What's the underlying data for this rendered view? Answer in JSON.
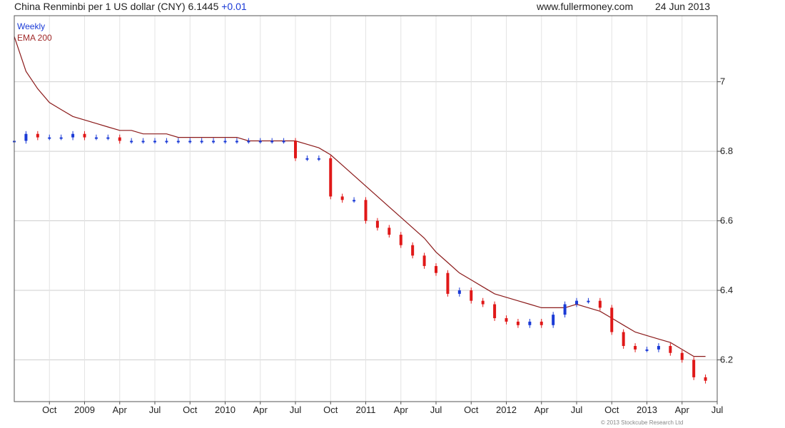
{
  "header": {
    "title": "China Renminbi per 1 US dollar (CNY) 6.1445",
    "change": "+0.01",
    "site": "www.fullermoney.com",
    "date": "24 Jun 2013"
  },
  "legend": {
    "line1": "Weekly",
    "line2": "EMA 200"
  },
  "copyright": "© 2013 Stockcube Research Ltd",
  "colors": {
    "up": "#1a3ad6",
    "down": "#e01818",
    "ema": "#8b1a1a",
    "grid": "#cfcfcf",
    "frame": "#555555"
  },
  "chart_data": {
    "type": "line",
    "title": "China Renminbi per 1 US dollar (CNY) 6.1445",
    "x_ticks": [
      "Oct",
      "2009",
      "Apr",
      "Jul",
      "Oct",
      "2010",
      "Apr",
      "Jul",
      "Oct",
      "2011",
      "Apr",
      "Jul",
      "Oct",
      "2012",
      "Apr",
      "Jul",
      "Oct",
      "2013",
      "Apr",
      "Jul"
    ],
    "y_ticks": [
      "6.2",
      "6.4",
      "6.6",
      "6.8",
      "7"
    ],
    "ylim": [
      6.08,
      7.19
    ],
    "xlim": [
      "2008-07",
      "2013-07"
    ],
    "grid": true,
    "legend_position": "top-left",
    "series": [
      {
        "name": "Weekly",
        "style": "candlestick",
        "x": [
          "2008-07",
          "2008-08",
          "2008-09",
          "2008-10",
          "2008-11",
          "2008-12",
          "2009-01",
          "2009-02",
          "2009-03",
          "2009-04",
          "2009-05",
          "2009-06",
          "2009-07",
          "2009-08",
          "2009-09",
          "2009-10",
          "2009-11",
          "2009-12",
          "2010-01",
          "2010-02",
          "2010-03",
          "2010-04",
          "2010-05",
          "2010-06",
          "2010-07",
          "2010-08",
          "2010-09",
          "2010-10",
          "2010-11",
          "2010-12",
          "2011-01",
          "2011-02",
          "2011-03",
          "2011-04",
          "2011-05",
          "2011-06",
          "2011-07",
          "2011-08",
          "2011-09",
          "2011-10",
          "2011-11",
          "2011-12",
          "2012-01",
          "2012-02",
          "2012-03",
          "2012-04",
          "2012-05",
          "2012-06",
          "2012-07",
          "2012-08",
          "2012-09",
          "2012-10",
          "2012-11",
          "2012-12",
          "2013-01",
          "2013-02",
          "2013-03",
          "2013-04",
          "2013-05",
          "2013-06"
        ],
        "values": [
          6.83,
          6.85,
          6.84,
          6.84,
          6.84,
          6.85,
          6.84,
          6.84,
          6.84,
          6.83,
          6.83,
          6.83,
          6.83,
          6.83,
          6.83,
          6.83,
          6.83,
          6.83,
          6.83,
          6.83,
          6.83,
          6.83,
          6.83,
          6.83,
          6.78,
          6.78,
          6.78,
          6.67,
          6.66,
          6.66,
          6.6,
          6.58,
          6.56,
          6.53,
          6.5,
          6.47,
          6.45,
          6.39,
          6.4,
          6.37,
          6.36,
          6.32,
          6.31,
          6.3,
          6.31,
          6.3,
          6.33,
          6.36,
          6.37,
          6.37,
          6.35,
          6.28,
          6.24,
          6.23,
          6.23,
          6.24,
          6.22,
          6.2,
          6.15,
          6.14
        ]
      },
      {
        "name": "EMA 200",
        "x": [
          "2008-07",
          "2008-08",
          "2008-09",
          "2008-10",
          "2008-11",
          "2008-12",
          "2009-01",
          "2009-02",
          "2009-03",
          "2009-04",
          "2009-05",
          "2009-06",
          "2009-07",
          "2009-08",
          "2009-09",
          "2009-10",
          "2009-11",
          "2009-12",
          "2010-01",
          "2010-02",
          "2010-03",
          "2010-04",
          "2010-05",
          "2010-06",
          "2010-07",
          "2010-08",
          "2010-09",
          "2010-10",
          "2010-11",
          "2010-12",
          "2011-01",
          "2011-02",
          "2011-03",
          "2011-04",
          "2011-05",
          "2011-06",
          "2011-07",
          "2011-08",
          "2011-09",
          "2011-10",
          "2011-11",
          "2011-12",
          "2012-01",
          "2012-02",
          "2012-03",
          "2012-04",
          "2012-05",
          "2012-06",
          "2012-07",
          "2012-08",
          "2012-09",
          "2012-10",
          "2012-11",
          "2012-12",
          "2013-01",
          "2013-02",
          "2013-03",
          "2013-04",
          "2013-05",
          "2013-06"
        ],
        "values": [
          7.13,
          7.03,
          6.98,
          6.94,
          6.92,
          6.9,
          6.89,
          6.88,
          6.87,
          6.86,
          6.86,
          6.85,
          6.85,
          6.85,
          6.84,
          6.84,
          6.84,
          6.84,
          6.84,
          6.84,
          6.83,
          6.83,
          6.83,
          6.83,
          6.83,
          6.82,
          6.81,
          6.79,
          6.76,
          6.73,
          6.7,
          6.67,
          6.64,
          6.61,
          6.58,
          6.55,
          6.51,
          6.48,
          6.45,
          6.43,
          6.41,
          6.39,
          6.38,
          6.37,
          6.36,
          6.35,
          6.35,
          6.35,
          6.36,
          6.35,
          6.34,
          6.32,
          6.3,
          6.28,
          6.27,
          6.26,
          6.25,
          6.23,
          6.21,
          6.21
        ]
      }
    ]
  }
}
